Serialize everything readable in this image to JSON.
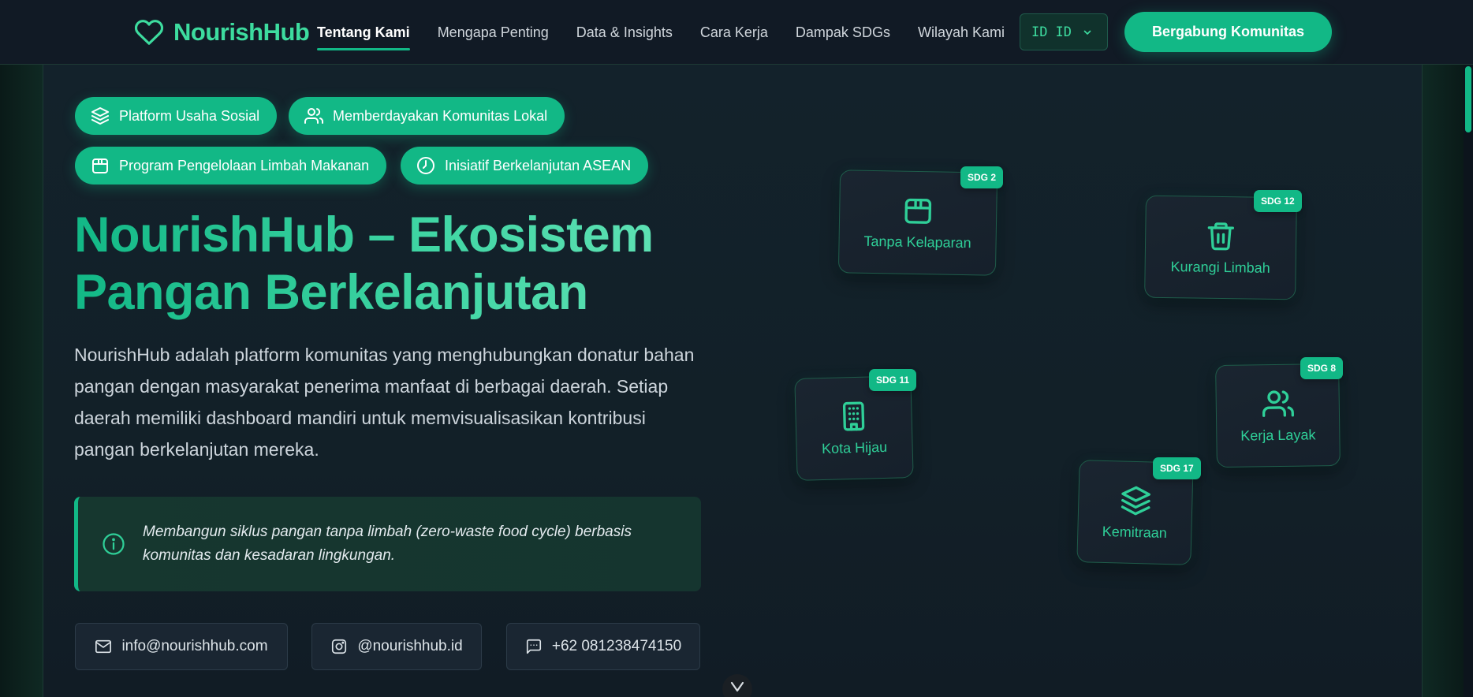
{
  "brand": {
    "name": "NourishHub",
    "icon": "heart-icon"
  },
  "nav": {
    "links": [
      {
        "label": "Tentang Kami",
        "active": true
      },
      {
        "label": "Mengapa Penting"
      },
      {
        "label": "Data & Insights"
      },
      {
        "label": "Cara Kerja"
      },
      {
        "label": "Dampak SDGs"
      },
      {
        "label": "Wilayah Kami"
      }
    ],
    "lang": {
      "code": "ID",
      "selected": "ID"
    },
    "cta": "Bergabung Komunitas"
  },
  "hero": {
    "chips": [
      {
        "label": "Platform Usaha Sosial",
        "icon": "layers-icon"
      },
      {
        "label": "Memberdayakan Komunitas Lokal",
        "icon": "users-icon"
      },
      {
        "label": "Program Pengelolaan Limbah Makanan",
        "icon": "box-icon"
      },
      {
        "label": "Inisiatif Berkelanjutan ASEAN",
        "icon": "clock-icon"
      }
    ],
    "title_line1": "NourishHub – Ekosistem",
    "title_line2": "Pangan Berkelanjutan",
    "description": "NourishHub adalah platform komunitas yang menghubungkan donatur bahan pangan dengan masyarakat penerima manfaat di berbagai daerah. Setiap daerah memiliki dashboard mandiri untuk memvisualisasikan kontribusi pangan berkelanjutan mereka.",
    "info": "Membangun siklus pangan tanpa limbah (zero-waste food cycle) berbasis komunitas dan kesadaran lingkungan.",
    "contacts": [
      {
        "label": "info@nourishhub.com",
        "icon": "mail-icon"
      },
      {
        "label": "@nourishhub.id",
        "icon": "instagram-icon"
      },
      {
        "label": "+62 081238474150",
        "icon": "message-icon"
      }
    ]
  },
  "sdgs": [
    {
      "badge": "SDG 2",
      "label": "Tanpa Kelaparan",
      "icon": "box-icon"
    },
    {
      "badge": "SDG 12",
      "label": "Kurangi Limbah",
      "icon": "trash-icon"
    },
    {
      "badge": "SDG 11",
      "label": "Kota Hijau",
      "icon": "building-icon"
    },
    {
      "badge": "SDG 8",
      "label": "Kerja Layak",
      "icon": "users-icon"
    },
    {
      "badge": "SDG 17",
      "label": "Kemitraan",
      "icon": "layers-icon"
    }
  ],
  "colors": {
    "accent": "#12b886",
    "accent_light": "#3ddc9f",
    "background": "#111a25"
  }
}
